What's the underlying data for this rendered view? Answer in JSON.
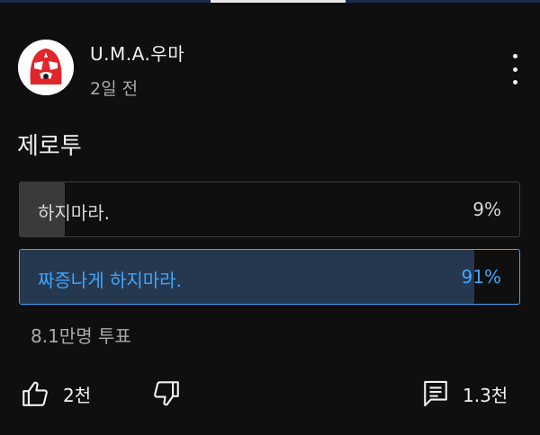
{
  "channel": {
    "name": "U.M.A.우마",
    "posted": "2일 전",
    "avatar_icon": "red-mask-avatar-icon"
  },
  "post": {
    "text": "제로투"
  },
  "poll": {
    "options": [
      {
        "label": "하지마라.",
        "percent": "9%",
        "fill": 0.09,
        "selected": false
      },
      {
        "label": "짜증나게 하지마라.",
        "percent": "91%",
        "fill": 0.91,
        "selected": true
      }
    ],
    "votes": "8.1만명 투표",
    "selected_color": "#3ea6ff"
  },
  "actions": {
    "likes": "2천",
    "comments": "1.3천",
    "like_icon": "thumbs-up-icon",
    "dislike_icon": "thumbs-down-icon",
    "comment_icon": "comment-icon",
    "menu_icon": "more-vertical-icon"
  }
}
